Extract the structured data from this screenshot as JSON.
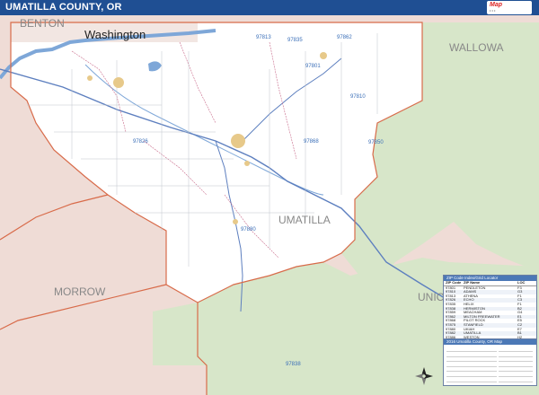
{
  "title": "UMATILLA COUNTY, OR",
  "map_labels": {
    "benton": "BENTON",
    "washington": "Washington",
    "wallowa": "WALLOWA",
    "umatilla": "UMATILLA",
    "morrow": "MORROW",
    "union": "UNIC"
  },
  "zip_codes": [
    "97813",
    "97835",
    "97862",
    "97801",
    "97810",
    "97826",
    "97868",
    "97880",
    "97850",
    "97838"
  ],
  "zip_panel": {
    "title": "ZIP Code Index/Grid Locator",
    "headers": {
      "zip": "ZIP Code",
      "name": "ZIP Name",
      "loc": "LOC"
    },
    "rows": [
      {
        "zip": "97801",
        "name": "PENDLETON",
        "loc": "F3"
      },
      {
        "zip": "97810",
        "name": "ADAMS",
        "loc": "G3"
      },
      {
        "zip": "97813",
        "name": "ATHENA",
        "loc": "F1"
      },
      {
        "zip": "97826",
        "name": "ECHO",
        "loc": "C3"
      },
      {
        "zip": "97835",
        "name": "HELIX",
        "loc": "F1"
      },
      {
        "zip": "97838",
        "name": "HERMISTON",
        "loc": "B2"
      },
      {
        "zip": "97859",
        "name": "MEACHAM",
        "loc": "G4"
      },
      {
        "zip": "97862",
        "name": "MILTON FREEWATER",
        "loc": "E1"
      },
      {
        "zip": "97868",
        "name": "PILOT ROCK",
        "loc": "E5"
      },
      {
        "zip": "97875",
        "name": "STANFIELD",
        "loc": "C2"
      },
      {
        "zip": "97880",
        "name": "UKIAH",
        "loc": "E7"
      },
      {
        "zip": "97882",
        "name": "UMATILLA",
        "loc": "B1"
      },
      {
        "zip": "97886",
        "name": "WESTON",
        "loc": "H2"
      }
    ]
  },
  "legend_panel": {
    "title": "2016 Umatilla County, OR Map"
  },
  "colors": {
    "title_bar": "#1f4f93",
    "forest": "#d7e6c9",
    "desert": "#efdcd6",
    "water": "#7ea7d8",
    "highway": "#5d7fbf",
    "boundary": "#d86b4a",
    "road": "#bfc4cc"
  },
  "icons": {
    "compass": "north-arrow-icon",
    "logo": "map-publisher-logo"
  }
}
